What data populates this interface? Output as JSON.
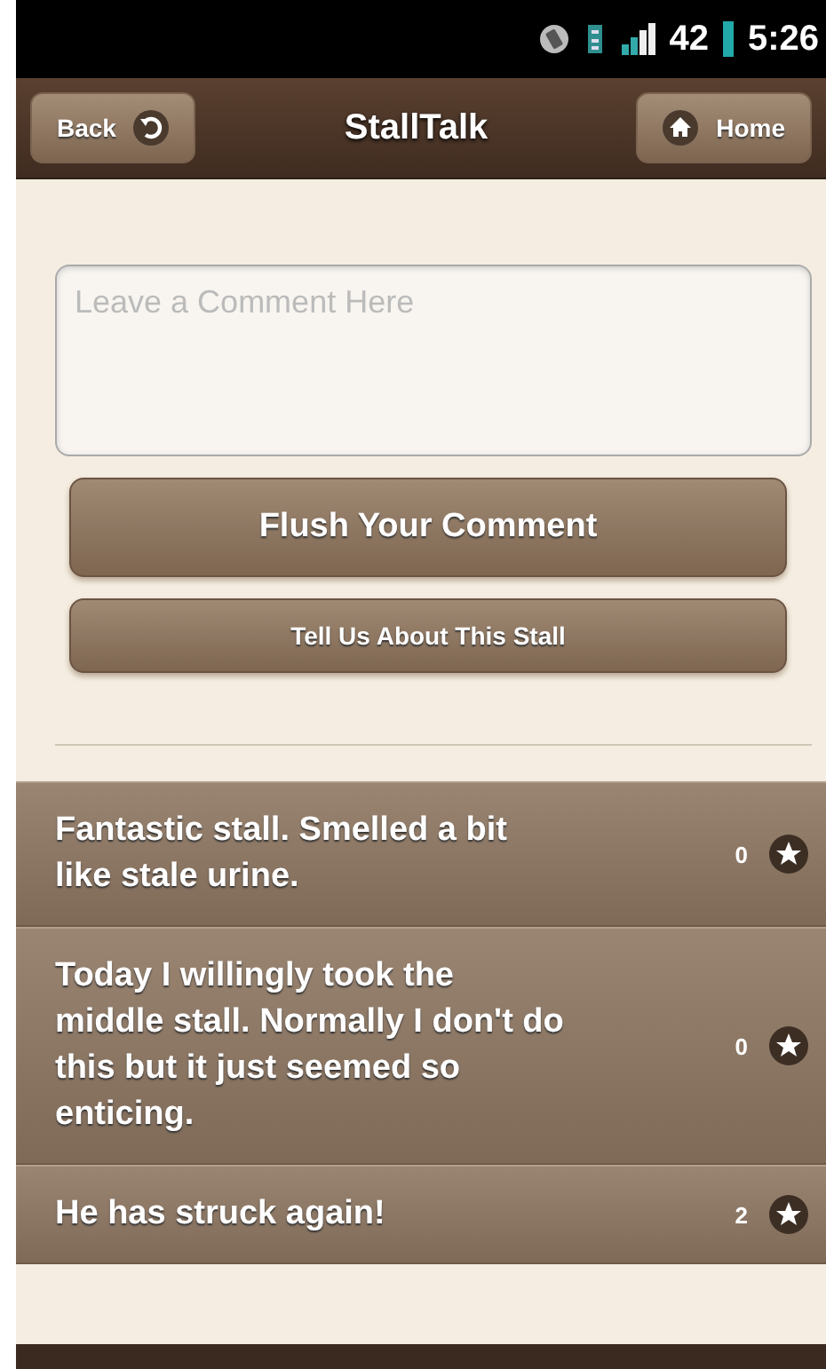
{
  "status_bar": {
    "battery": "42",
    "time": "5:26"
  },
  "header": {
    "back": "Back",
    "title": "StallTalk",
    "home": "Home"
  },
  "comment_field": {
    "placeholder": "Leave a Comment Here"
  },
  "buttons": [
    {
      "label": "Flush Your Comment",
      "kind": "large"
    },
    {
      "label": "Tell Us About This Stall",
      "kind": "small"
    }
  ],
  "comments": [
    {
      "text": "Fantastic stall. Smelled a bit like stale urine.",
      "count": "0"
    },
    {
      "text": "Today I willingly took the middle stall. Normally I don't do this but it just seemed so enticing.",
      "count": "0"
    },
    {
      "text": "He has struck again!",
      "count": "2"
    }
  ]
}
